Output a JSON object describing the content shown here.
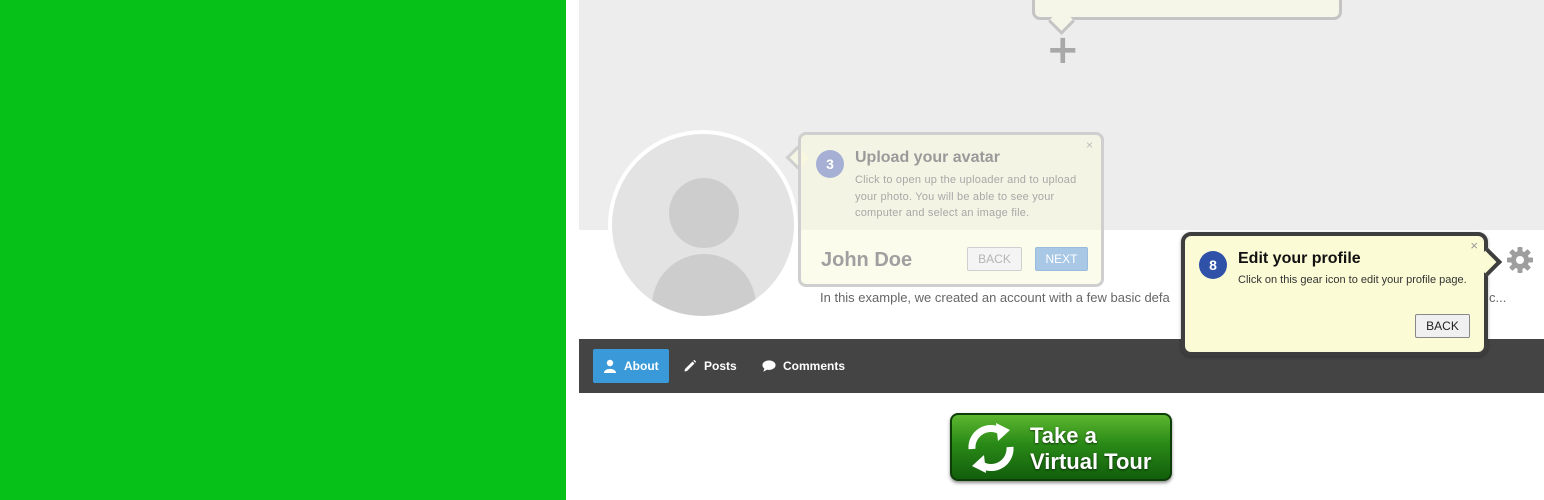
{
  "profile": {
    "name": "John Doe",
    "description": "In this example, we created an account with a few basic default...",
    "description_left": "In this example, we created an account with a few basic defa",
    "description_right": "c..."
  },
  "nav": {
    "tabs": [
      {
        "label": "About",
        "icon": "user-icon",
        "active": true
      },
      {
        "label": "Posts",
        "icon": "pencil-icon",
        "active": false
      },
      {
        "label": "Comments",
        "icon": "speech-bubble-icon",
        "active": false
      }
    ]
  },
  "tooltips": {
    "avatar": {
      "step": "3",
      "title": "Upload your avatar",
      "body": "Click to open up the uploader and to upload your photo. You will be able to see your computer and select an image file.",
      "back_label": "BACK",
      "next_label": "NEXT",
      "close": "×"
    },
    "edit_profile": {
      "step": "8",
      "title": "Edit your profile",
      "body": "Click on this gear icon to edit your profile page.",
      "back_label": "BACK",
      "close": "×"
    }
  },
  "cover": {
    "add_symbol": "+"
  },
  "tour_button": {
    "line1": "Take a",
    "line2": "Virtual Tour",
    "icon": "refresh-arrows-icon"
  },
  "colors": {
    "green_panel": "#06c118",
    "nav_active": "#3a9ad9",
    "nav_bar": "#444444",
    "step_active": "#2f51a8"
  }
}
